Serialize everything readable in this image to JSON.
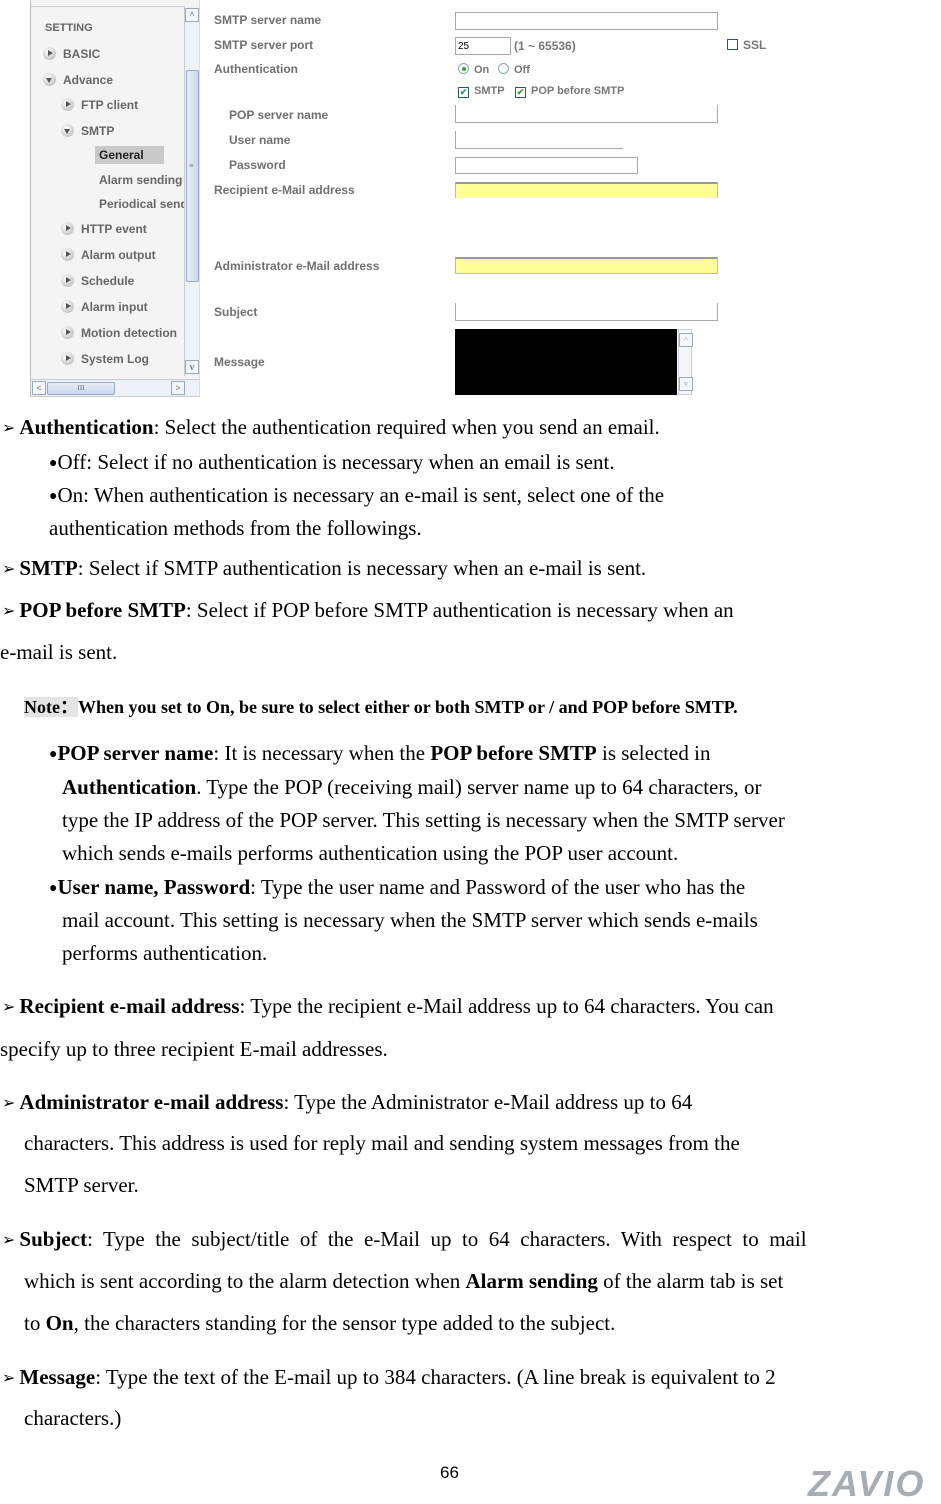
{
  "sidebar": {
    "heading": "SETTING",
    "items": [
      {
        "label": "BASIC",
        "state": "collapsed"
      },
      {
        "label": "Advance",
        "state": "expanded"
      },
      {
        "label": "FTP client",
        "state": "collapsed"
      },
      {
        "label": "SMTP",
        "state": "expanded"
      },
      {
        "label": "General",
        "state": "selected"
      },
      {
        "label": "Alarm sending"
      },
      {
        "label": "Periodical send"
      },
      {
        "label": "HTTP event",
        "state": "collapsed"
      },
      {
        "label": "Alarm output",
        "state": "collapsed"
      },
      {
        "label": "Schedule",
        "state": "collapsed"
      },
      {
        "label": "Alarm input",
        "state": "collapsed"
      },
      {
        "label": "Motion detection",
        "state": "collapsed"
      },
      {
        "label": "System Log",
        "state": "collapsed"
      }
    ],
    "scroll_up": "^",
    "scroll_down": "v",
    "scroll_left": "<",
    "scroll_right": ">",
    "hthumb_grip": "III",
    "vthumb_grip": "≡"
  },
  "form": {
    "smtp_server_name": {
      "label": "SMTP server name",
      "value": ""
    },
    "smtp_server_port": {
      "label": "SMTP server port",
      "value": "25",
      "range": "(1 ~ 65536)"
    },
    "ssl": {
      "label": "SSL",
      "checked": false
    },
    "authentication": {
      "label": "Authentication",
      "on_label": "On",
      "off_label": "Off",
      "selected": "On"
    },
    "auth_methods": {
      "smtp_label": "SMTP",
      "smtp_checked": true,
      "pop_label": "POP before SMTP",
      "pop_checked": true,
      "check_glyph": "✔"
    },
    "pop_server_name": {
      "label": "POP server name",
      "value": ""
    },
    "user_name": {
      "label": "User name",
      "value": ""
    },
    "password": {
      "label": "Password",
      "value": ""
    },
    "recipient": {
      "label": "Recipient e-Mail address",
      "value": ""
    },
    "administrator": {
      "label": "Administrator e-Mail address",
      "value": ""
    },
    "subject": {
      "label": "Subject",
      "value": ""
    },
    "message": {
      "label": "Message",
      "value": ""
    }
  },
  "doc": {
    "bullet_arrow": "➢",
    "dot": "●",
    "authentication": {
      "term": "Authentication",
      "text": ": Select the authentication required when you send an email."
    },
    "auth_off": "Off: Select if no authentication is necessary when an email is sent.",
    "auth_on_1": "On: When authentication is necessary an e-mail is sent, select one of the",
    "auth_on_2": "authentication methods from the followings.",
    "smtp": {
      "term": "SMTP",
      "text": ": Select if SMTP authentication is necessary when an e-mail is sent."
    },
    "pop_before_smtp": {
      "term": "POP before SMTP",
      "text1": ": Select if POP before SMTP authentication is necessary when an",
      "text2": "e-mail is sent."
    },
    "note": {
      "label": "Note：",
      "text": "When you set to On, be sure to select either or both SMTP or / and POP before SMTP."
    },
    "pop_server": {
      "term": "POP server name",
      "t1": ": It is necessary when the ",
      "b1": "POP before SMTP",
      "t2": " is selected in",
      "b2": "Authentication",
      "t3": ". Type the POP (receiving mail) server name up to 64 characters, or",
      "line3": "type the IP address of the POP server. This setting is necessary when the SMTP server",
      "line4": "which sends e-mails performs authentication using the POP user account."
    },
    "user_pass": {
      "term": "User name, Password",
      "t1": ": Type the user name and Password of the user who has the",
      "line2": "mail account. This setting is necessary when the SMTP server which sends e-mails",
      "line3": "performs authentication."
    },
    "recipient": {
      "term": "Recipient e-mail address",
      "text1": ": Type the recipient e-Mail address up to 64 characters. You can",
      "text2": "specify up to three recipient E-mail addresses."
    },
    "administrator": {
      "term": "Administrator e-mail address",
      "text1": ": Type the Administrator e-Mail address up to 64",
      "text2": "characters. This address is used for reply mail and sending system messages from the",
      "text3": "SMTP server."
    },
    "subject": {
      "term": "Subject",
      "text1": ":  Type  the  subject/title  of  the  e-Mail  up  to  64  characters.  With  respect  to  mail",
      "t2a": "which is sent according to the alarm detection when ",
      "b2": "Alarm sending",
      "t2b": " of the alarm tab is set",
      "t3a": "to ",
      "b3": "On",
      "t3b": ", the characters standing for the sensor type added to the subject."
    },
    "message": {
      "term": "Message",
      "text1": ": Type the text of the E-mail up to 384 characters. (A line break is equivalent to 2",
      "text2": "characters.)"
    }
  },
  "footer": {
    "page_number": "66",
    "logo": "ZAVIO"
  }
}
